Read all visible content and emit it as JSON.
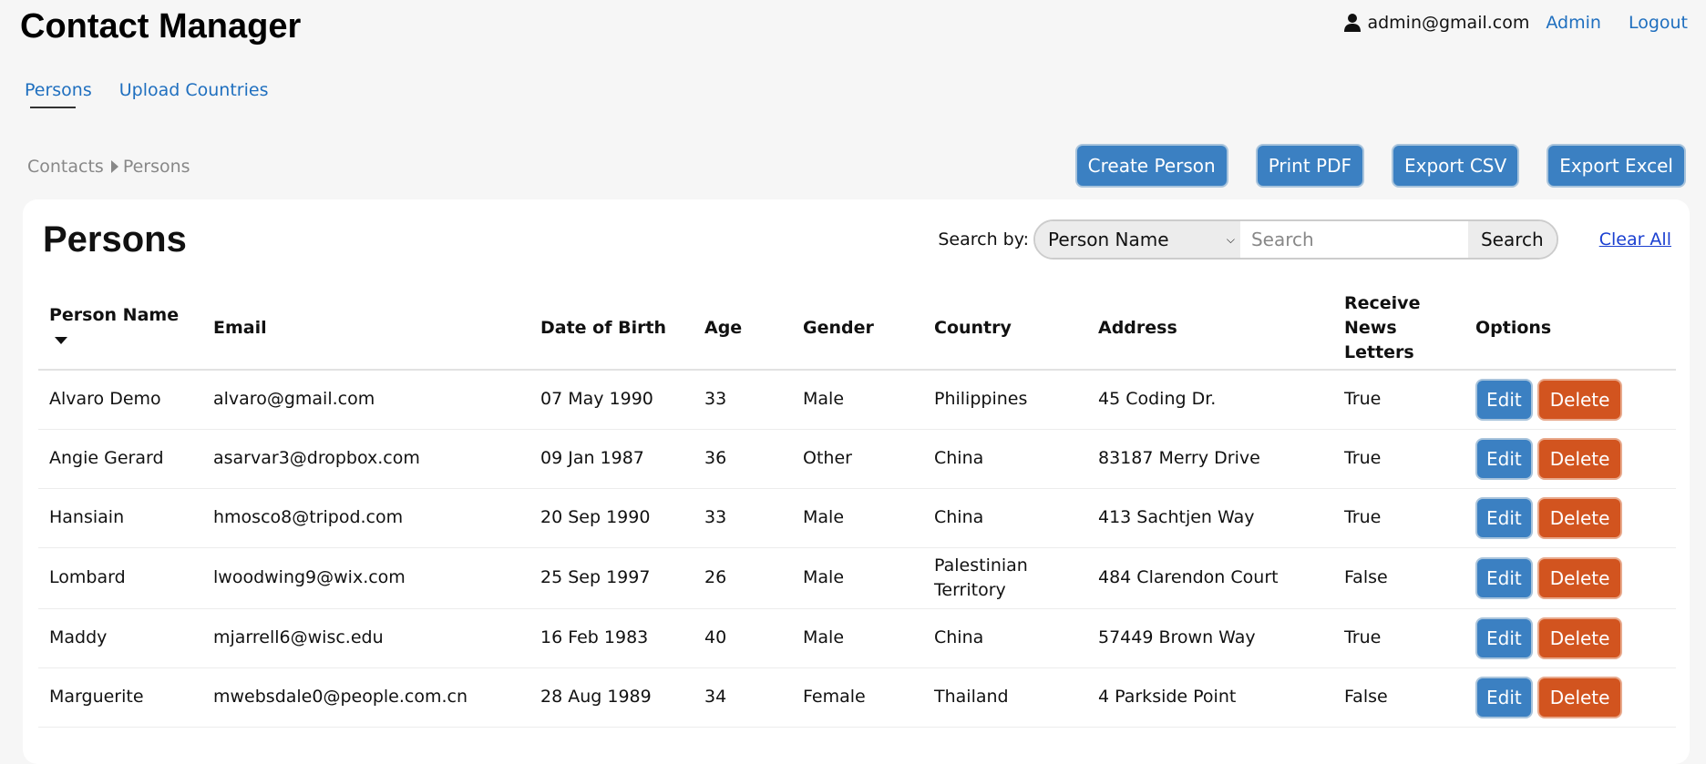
{
  "header": {
    "title": "Contact Manager",
    "user_email": "admin@gmail.com",
    "admin_link": "Admin",
    "logout_link": "Logout"
  },
  "nav": {
    "items": [
      {
        "label": "Persons",
        "active": true
      },
      {
        "label": "Upload Countries",
        "active": false
      }
    ]
  },
  "breadcrumb": {
    "items": [
      "Contacts",
      "Persons"
    ]
  },
  "actions": {
    "create": "Create Person",
    "print_pdf": "Print PDF",
    "export_csv": "Export CSV",
    "export_excel": "Export Excel"
  },
  "main": {
    "title": "Persons",
    "search": {
      "label": "Search by:",
      "selected_field": "Person Name",
      "placeholder": "Search",
      "value": "",
      "button": "Search",
      "clear_all": "Clear All"
    },
    "table": {
      "columns": [
        "Person Name",
        "Email",
        "Date of Birth",
        "Age",
        "Gender",
        "Country",
        "Address",
        "Receive News Letters",
        "Options"
      ],
      "sorted_column": "Person Name",
      "edit_label": "Edit",
      "delete_label": "Delete",
      "rows": [
        [
          "Alvaro Demo",
          "alvaro@gmail.com",
          "07 May 1990",
          "33",
          "Male",
          "Philippines",
          "45 Coding Dr.",
          "True"
        ],
        [
          "Angie Gerard",
          "asarvar3@dropbox.com",
          "09 Jan 1987",
          "36",
          "Other",
          "China",
          "83187 Merry Drive",
          "True"
        ],
        [
          "Hansiain",
          "hmosco8@tripod.com",
          "20 Sep 1990",
          "33",
          "Male",
          "China",
          "413 Sachtjen Way",
          "True"
        ],
        [
          "Lombard",
          "lwoodwing9@wix.com",
          "25 Sep 1997",
          "26",
          "Male",
          "Palestinian Territory",
          "484 Clarendon Court",
          "False"
        ],
        [
          "Maddy",
          "mjarrell6@wisc.edu",
          "16 Feb 1983",
          "40",
          "Male",
          "China",
          "57449 Brown Way",
          "True"
        ],
        [
          "Marguerite",
          "mwebsdale0@people.com.cn",
          "28 Aug 1989",
          "34",
          "Female",
          "Thailand",
          "4 Parkside Point",
          "False"
        ]
      ]
    }
  },
  "colors": {
    "primary_button": "#3b80c2",
    "delete_button": "#d2541f",
    "link": "#1f6fbf",
    "background": "#f6f6f6"
  },
  "icons": {
    "user": "user-icon",
    "sort": "sort-desc-icon",
    "breadcrumb_separator": "caret-right-icon",
    "select": "chevron-down-icon"
  }
}
